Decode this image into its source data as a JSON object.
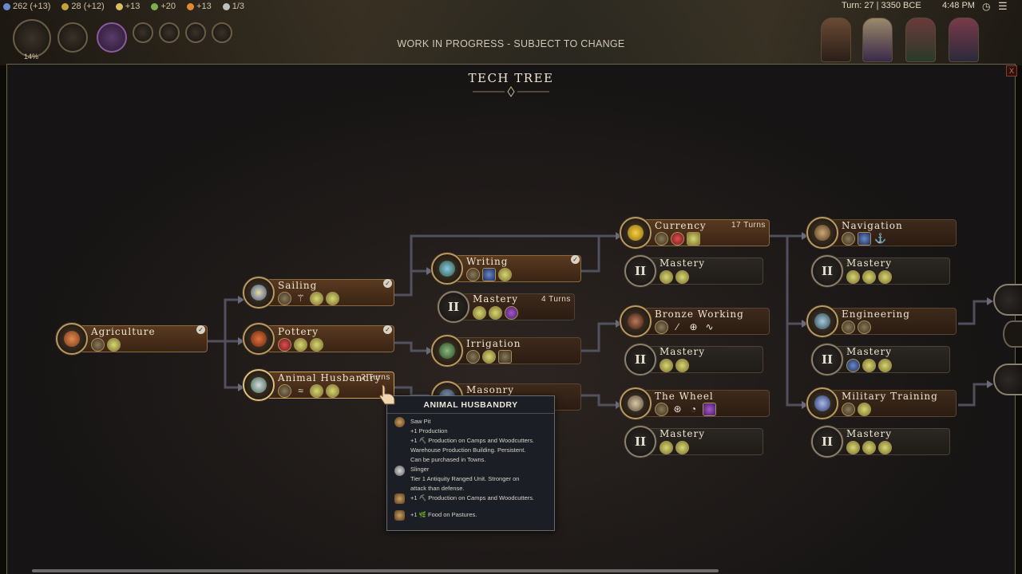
{
  "topbar": {
    "resources": [
      "262 (+13)",
      "28 (+12)",
      "+13",
      "+20",
      "+13",
      "1/3"
    ],
    "resource_colors": [
      "#6a8ad0",
      "#c8a038",
      "#d8c060",
      "#7ab050",
      "#e08a30",
      "#c0c0c0"
    ],
    "percent": "14%",
    "turn_info": "Turn: 27 | 3350 BCE",
    "clock": "4:48 PM",
    "wip_notice": "WORK IN PROGRESS - SUBJECT TO CHANGE"
  },
  "panel": {
    "title": "TECH TREE",
    "close_label": "X"
  },
  "techs": [
    {
      "name": "Agriculture",
      "turns": "",
      "done": true
    },
    {
      "name": "Sailing",
      "turns": "",
      "done": true
    },
    {
      "name": "Pottery",
      "turns": "",
      "done": true
    },
    {
      "name": "Animal Husbandry",
      "turns": "2 Turns",
      "done": false
    },
    {
      "name": "Writing",
      "turns": "",
      "done": true
    },
    {
      "name": "Mastery",
      "turns": "4 Turns",
      "done": false
    },
    {
      "name": "Irrigation",
      "turns": "",
      "done": false
    },
    {
      "name": "Masonry",
      "turns": "",
      "done": false
    },
    {
      "name": "Currency",
      "turns": "17 Turns",
      "done": false
    },
    {
      "name": "Mastery",
      "turns": "",
      "done": false
    },
    {
      "name": "Bronze Working",
      "turns": "",
      "done": false
    },
    {
      "name": "Mastery",
      "turns": "",
      "done": false
    },
    {
      "name": "The Wheel",
      "turns": "",
      "done": false
    },
    {
      "name": "Mastery",
      "turns": "",
      "done": false
    },
    {
      "name": "Navigation",
      "turns": "",
      "done": false
    },
    {
      "name": "Mastery",
      "turns": "",
      "done": false
    },
    {
      "name": "Engineering",
      "turns": "",
      "done": false
    },
    {
      "name": "Mastery",
      "turns": "",
      "done": false
    },
    {
      "name": "Military Training",
      "turns": "",
      "done": false
    },
    {
      "name": "Mastery",
      "turns": "",
      "done": false
    }
  ],
  "mastery_numeral": "II",
  "check_glyph": "✓",
  "tooltip": {
    "title": "ANIMAL HUSBANDRY",
    "lines": [
      "Saw Pit",
      "+1 Production",
      "+1 ⛏ Production on Camps and Woodcutters.",
      "Warehouse Production Building. Persistent.",
      "Can be purchased in Towns.",
      "Slinger",
      "Tier 1 Antiquity Ranged Unit. Stronger on",
      "attack than defense.",
      "+1 ⛏ Production on Camps and Woodcutters.",
      "+1 🌿 Food on Pastures."
    ]
  }
}
